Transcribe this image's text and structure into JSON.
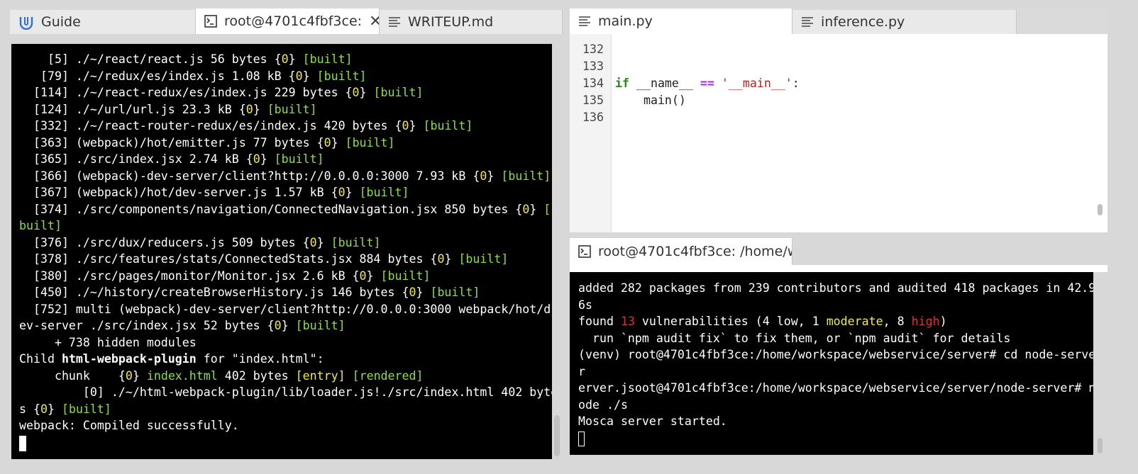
{
  "left_panel": {
    "tabs": [
      {
        "label": "Guide",
        "icon": "guide-icon",
        "active": false
      },
      {
        "label": "root@4701c4fbf3ce:",
        "icon": "terminal-icon",
        "active": true,
        "closable": true
      },
      {
        "label": "WRITEUP.md",
        "icon": "document-icon",
        "active": false
      }
    ],
    "terminal": {
      "lines": [
        {
          "segments": [
            {
              "t": "    [5] ./~/react/react.js 56 bytes {"
            },
            {
              "t": "0",
              "c": "y"
            },
            {
              "t": "} "
            },
            {
              "t": "[built]",
              "c": "g"
            }
          ]
        },
        {
          "segments": [
            {
              "t": "   [79] ./~/redux/es/index.js 1.08 kB {"
            },
            {
              "t": "0",
              "c": "y"
            },
            {
              "t": "} "
            },
            {
              "t": "[built]",
              "c": "g"
            }
          ]
        },
        {
          "segments": [
            {
              "t": "  [114] ./~/react-redux/es/index.js 229 bytes {"
            },
            {
              "t": "0",
              "c": "y"
            },
            {
              "t": "} "
            },
            {
              "t": "[built]",
              "c": "g"
            }
          ]
        },
        {
          "segments": [
            {
              "t": "  [124] ./~/url/url.js 23.3 kB {"
            },
            {
              "t": "0",
              "c": "y"
            },
            {
              "t": "} "
            },
            {
              "t": "[built]",
              "c": "g"
            }
          ]
        },
        {
          "segments": [
            {
              "t": "  [332] ./~/react-router-redux/es/index.js 420 bytes {"
            },
            {
              "t": "0",
              "c": "y"
            },
            {
              "t": "} "
            },
            {
              "t": "[built]",
              "c": "g"
            }
          ]
        },
        {
          "segments": [
            {
              "t": "  [363] (webpack)/hot/emitter.js 77 bytes {"
            },
            {
              "t": "0",
              "c": "y"
            },
            {
              "t": "} "
            },
            {
              "t": "[built]",
              "c": "g"
            }
          ]
        },
        {
          "segments": [
            {
              "t": "  [365] ./src/index.jsx 2.74 kB {"
            },
            {
              "t": "0",
              "c": "y"
            },
            {
              "t": "} "
            },
            {
              "t": "[built]",
              "c": "g"
            }
          ]
        },
        {
          "segments": [
            {
              "t": "  [366] (webpack)-dev-server/client?http://0.0.0.0:3000 7.93 kB {"
            },
            {
              "t": "0",
              "c": "y"
            },
            {
              "t": "} "
            },
            {
              "t": "[built]",
              "c": "g"
            }
          ]
        },
        {
          "segments": [
            {
              "t": "  [367] (webpack)/hot/dev-server.js 1.57 kB {"
            },
            {
              "t": "0",
              "c": "y"
            },
            {
              "t": "} "
            },
            {
              "t": "[built]",
              "c": "g"
            }
          ]
        },
        {
          "segments": [
            {
              "t": "  [374] ./src/components/navigation/ConnectedNavigation.jsx 850 bytes {"
            },
            {
              "t": "0",
              "c": "y"
            },
            {
              "t": "} "
            },
            {
              "t": "[",
              "c": "g"
            }
          ]
        },
        {
          "segments": [
            {
              "t": "built]",
              "c": "g"
            }
          ]
        },
        {
          "segments": [
            {
              "t": "  [376] ./src/dux/reducers.js 509 bytes {"
            },
            {
              "t": "0",
              "c": "y"
            },
            {
              "t": "} "
            },
            {
              "t": "[built]",
              "c": "g"
            }
          ]
        },
        {
          "segments": [
            {
              "t": "  [378] ./src/features/stats/ConnectedStats.jsx 884 bytes {"
            },
            {
              "t": "0",
              "c": "y"
            },
            {
              "t": "} "
            },
            {
              "t": "[built]",
              "c": "g"
            }
          ]
        },
        {
          "segments": [
            {
              "t": "  [380] ./src/pages/monitor/Monitor.jsx 2.6 kB {"
            },
            {
              "t": "0",
              "c": "y"
            },
            {
              "t": "} "
            },
            {
              "t": "[built]",
              "c": "g"
            }
          ]
        },
        {
          "segments": [
            {
              "t": "  [450] ./~/history/createBrowserHistory.js 146 bytes {"
            },
            {
              "t": "0",
              "c": "y"
            },
            {
              "t": "} "
            },
            {
              "t": "[built]",
              "c": "g"
            }
          ]
        },
        {
          "segments": [
            {
              "t": "  [752] multi (webpack)-dev-server/client?http://0.0.0.0:3000 webpack/hot/d"
            }
          ]
        },
        {
          "segments": [
            {
              "t": "ev-server ./src/index.jsx 52 bytes {"
            },
            {
              "t": "0",
              "c": "y"
            },
            {
              "t": "} "
            },
            {
              "t": "[built]",
              "c": "g"
            }
          ]
        },
        {
          "segments": [
            {
              "t": "     + 738 hidden modules"
            }
          ]
        },
        {
          "segments": [
            {
              "t": "Child "
            },
            {
              "t": "html-webpack-plugin",
              "c": "b"
            },
            {
              "t": " for \"index.html\":"
            }
          ]
        },
        {
          "segments": [
            {
              "t": "     chunk    {"
            },
            {
              "t": "0",
              "c": "y"
            },
            {
              "t": "} "
            },
            {
              "t": "index.html",
              "c": "g"
            },
            {
              "t": " 402 bytes "
            },
            {
              "t": "[entry]",
              "c": "y"
            },
            {
              "t": " "
            },
            {
              "t": "[rendered]",
              "c": "g"
            }
          ]
        },
        {
          "segments": [
            {
              "t": "         [0] ./~/html-webpack-plugin/lib/loader.js!./src/index.html 402 byte"
            }
          ]
        },
        {
          "segments": [
            {
              "t": "s {"
            },
            {
              "t": "0",
              "c": "y"
            },
            {
              "t": "} "
            },
            {
              "t": "[built]",
              "c": "g"
            }
          ]
        },
        {
          "segments": [
            {
              "t": "webpack: Compiled successfully."
            }
          ]
        }
      ]
    }
  },
  "editor_panel": {
    "tabs": [
      {
        "label": "main.py",
        "icon": "document-icon",
        "active": true
      },
      {
        "label": "inference.py",
        "icon": "document-icon",
        "active": false
      }
    ],
    "lines": [
      {
        "num": "132",
        "segments": []
      },
      {
        "num": "133",
        "segments": []
      },
      {
        "num": "134",
        "segments": [
          {
            "t": "if",
            "c": "kw"
          },
          {
            "t": " __name__ "
          },
          {
            "t": "==",
            "c": "op"
          },
          {
            "t": " "
          },
          {
            "t": "'__main__'",
            "c": "str"
          },
          {
            "t": ":"
          }
        ]
      },
      {
        "num": "135",
        "segments": [
          {
            "t": "    main()"
          }
        ]
      },
      {
        "num": "136",
        "segments": []
      }
    ]
  },
  "bottom_terminal_panel": {
    "tab": {
      "label": "root@4701c4fbf3ce: /home/w",
      "icon": "terminal-icon"
    },
    "lines": [
      {
        "segments": [
          {
            "t": "added 282 packages from 239 contributors and audited 418 packages in 42.9"
          }
        ]
      },
      {
        "segments": [
          {
            "t": "6s"
          }
        ]
      },
      {
        "segments": [
          {
            "t": "found "
          },
          {
            "t": "13",
            "c": "r"
          },
          {
            "t": " vulnerabilities (4 low, 1 "
          },
          {
            "t": "moderate",
            "c": "y"
          },
          {
            "t": ", 8 "
          },
          {
            "t": "high",
            "c": "r"
          },
          {
            "t": ")"
          }
        ]
      },
      {
        "segments": [
          {
            "t": "  run `npm audit fix` to fix them, or `npm audit` for details"
          }
        ]
      },
      {
        "segments": [
          {
            "t": "(venv) root@4701c4fbf3ce:/home/workspace/webservice/server# cd node-serve"
          }
        ]
      },
      {
        "segments": [
          {
            "t": "r"
          }
        ]
      },
      {
        "segments": [
          {
            "t": "erver.jsoot@4701c4fbf3ce:/home/workspace/webservice/server/node-server# n"
          }
        ]
      },
      {
        "segments": [
          {
            "t": "ode ./s"
          }
        ]
      },
      {
        "segments": [
          {
            "t": "Mosca server started."
          }
        ]
      }
    ]
  }
}
